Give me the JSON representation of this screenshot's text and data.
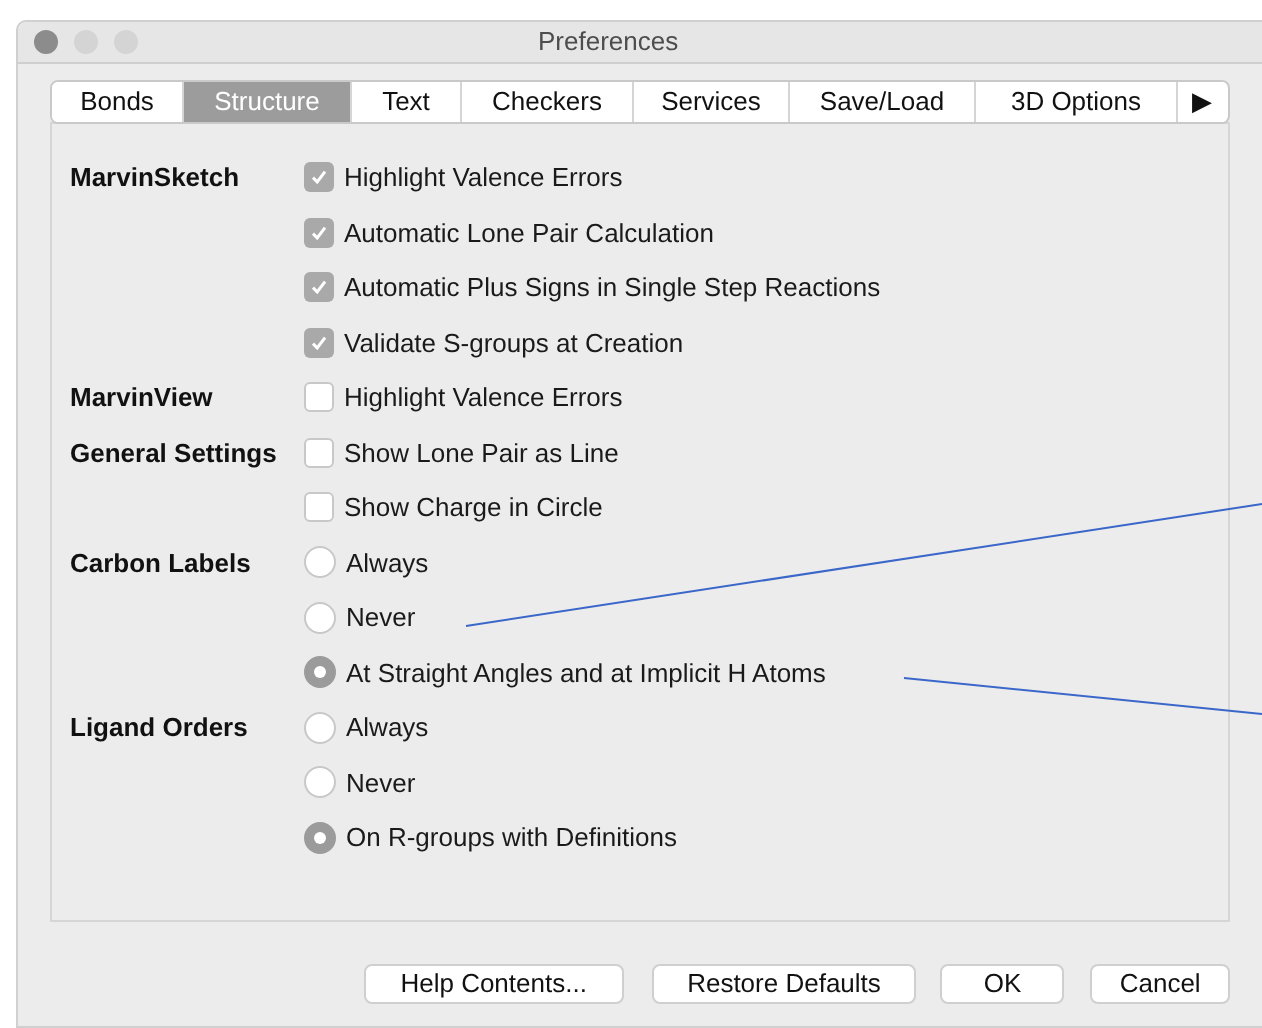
{
  "window": {
    "title": "Preferences"
  },
  "tabs": [
    {
      "label": "Bonds",
      "selected": false
    },
    {
      "label": "Structure",
      "selected": true
    },
    {
      "label": "Text",
      "selected": false
    },
    {
      "label": "Checkers",
      "selected": false
    },
    {
      "label": "Services",
      "selected": false
    },
    {
      "label": "Save/Load",
      "selected": false
    },
    {
      "label": "3D Options",
      "selected": false
    },
    {
      "label": "▶",
      "selected": false
    }
  ],
  "groups": [
    {
      "label": "MarvinSketch",
      "options": [
        {
          "kind": "checkbox",
          "text": "Highlight Valence Errors",
          "checked": true
        },
        {
          "kind": "checkbox",
          "text": "Automatic Lone Pair Calculation",
          "checked": true
        },
        {
          "kind": "checkbox",
          "text": "Automatic Plus Signs in Single Step Reactions",
          "checked": true
        },
        {
          "kind": "checkbox",
          "text": "Validate S-groups at Creation",
          "checked": true
        }
      ]
    },
    {
      "label": "MarvinView",
      "options": [
        {
          "kind": "checkbox",
          "text": "Highlight Valence Errors",
          "checked": false
        }
      ]
    },
    {
      "label": "General Settings",
      "options": [
        {
          "kind": "checkbox",
          "text": "Show Lone Pair as Line",
          "checked": false
        },
        {
          "kind": "checkbox",
          "text": "Show Charge in Circle",
          "checked": false
        }
      ]
    },
    {
      "label": "Carbon Labels",
      "options": [
        {
          "kind": "radio",
          "text": "Always",
          "selected": false
        },
        {
          "kind": "radio",
          "text": "Never",
          "selected": false
        },
        {
          "kind": "radio",
          "text": "At Straight Angles and at Implicit H Atoms",
          "selected": true
        }
      ]
    },
    {
      "label": "Ligand Orders",
      "options": [
        {
          "kind": "radio",
          "text": "Always",
          "selected": false
        },
        {
          "kind": "radio",
          "text": "Never",
          "selected": false
        },
        {
          "kind": "radio",
          "text": "On R-groups with Definitions",
          "selected": true
        }
      ]
    }
  ],
  "buttons": [
    "Help Contents...",
    "Restore Defaults",
    "OK",
    "Cancel"
  ]
}
